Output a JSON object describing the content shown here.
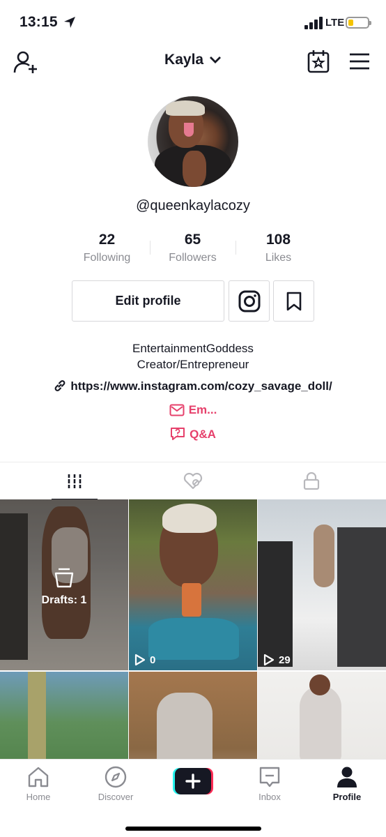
{
  "status_bar": {
    "time": "13:15",
    "network": "LTE"
  },
  "header": {
    "account_name": "Kayla"
  },
  "profile": {
    "username": "@queenkaylacozy",
    "stats": [
      {
        "value": "22",
        "label": "Following"
      },
      {
        "value": "65",
        "label": "Followers"
      },
      {
        "value": "108",
        "label": "Likes"
      }
    ],
    "edit_profile_label": "Edit profile",
    "bio_line1": "EntertainmentGoddess",
    "bio_line2": "Creator/Entrepreneur",
    "link": "https://www.instagram.com/cozy_savage_doll/",
    "email_label": "Em...",
    "qa_label": "Q&A"
  },
  "grid": {
    "drafts_label": "Drafts: 1",
    "videos": [
      {
        "views": "0"
      },
      {
        "views": "29"
      }
    ]
  },
  "bottom_nav": {
    "home": "Home",
    "discover": "Discover",
    "inbox": "Inbox",
    "profile": "Profile"
  },
  "colors": {
    "accent": "#e6406b",
    "text": "#161823",
    "muted": "#8a8b91"
  }
}
